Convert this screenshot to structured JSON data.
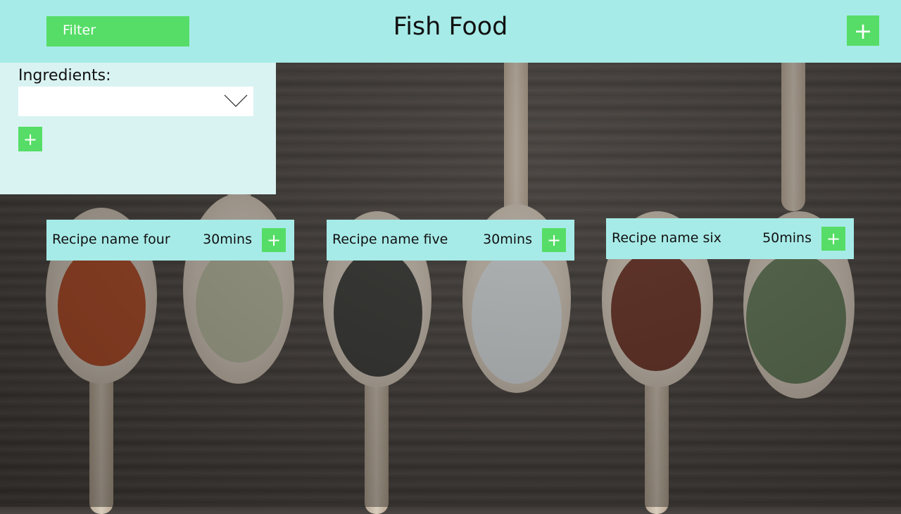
{
  "header": {
    "filter_label": "Filter",
    "title": "Fish Food",
    "add_icon": "plus-icon",
    "add_label": "+"
  },
  "filter_panel": {
    "ingredients_label": "Ingredients:",
    "ingredients_value": "",
    "add_label": "+"
  },
  "recipes": [
    {
      "name": "Recipe name four",
      "time": "30mins",
      "add_label": "+"
    },
    {
      "name": "Recipe name five",
      "time": "30mins",
      "add_label": "+"
    },
    {
      "name": "Recipe name six",
      "time": "50mins",
      "add_label": "+"
    }
  ],
  "colors": {
    "header_bg": "#a7ebe8",
    "accent": "#56dd67",
    "panel_bg": "#d9f3f2"
  }
}
